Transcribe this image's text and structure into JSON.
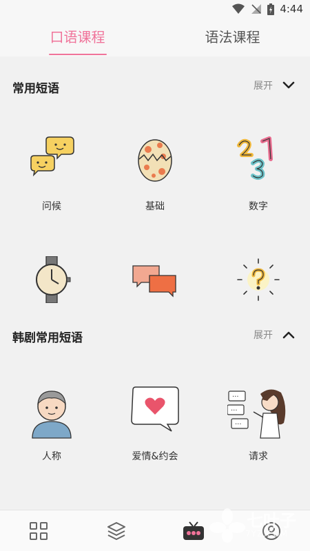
{
  "status": {
    "time": "4:44"
  },
  "tabs": [
    {
      "label": "口语课程",
      "active": true
    },
    {
      "label": "语法课程",
      "active": false
    }
  ],
  "sections": [
    {
      "title": "常用短语",
      "toggle_label": "展开",
      "expanded": false,
      "items": [
        {
          "label": "问候",
          "icon": "chat-bubbles-icon"
        },
        {
          "label": "基础",
          "icon": "hatching-egg-icon"
        },
        {
          "label": "数字",
          "icon": "numbers-123-icon"
        },
        {
          "label": "",
          "icon": "wristwatch-icon"
        },
        {
          "label": "",
          "icon": "two-cards-icon"
        },
        {
          "label": "",
          "icon": "question-mark-icon"
        }
      ]
    },
    {
      "title": "韩剧常用短语",
      "toggle_label": "展开",
      "expanded": true,
      "items": [
        {
          "label": "人称",
          "icon": "person-avatar-icon"
        },
        {
          "label": "爱情&约会",
          "icon": "heart-message-icon"
        },
        {
          "label": "请求",
          "icon": "girl-speaking-icon"
        }
      ]
    }
  ],
  "bottom_nav": [
    {
      "icon": "grid-icon"
    },
    {
      "icon": "layers-icon"
    },
    {
      "icon": "tv-icon"
    },
    {
      "icon": "profile-icon"
    }
  ],
  "watermark": {
    "text": "七叶子",
    "sub": "7YZ.COM"
  },
  "colors": {
    "accent": "#f0739a",
    "background": "#f1f1f1"
  }
}
